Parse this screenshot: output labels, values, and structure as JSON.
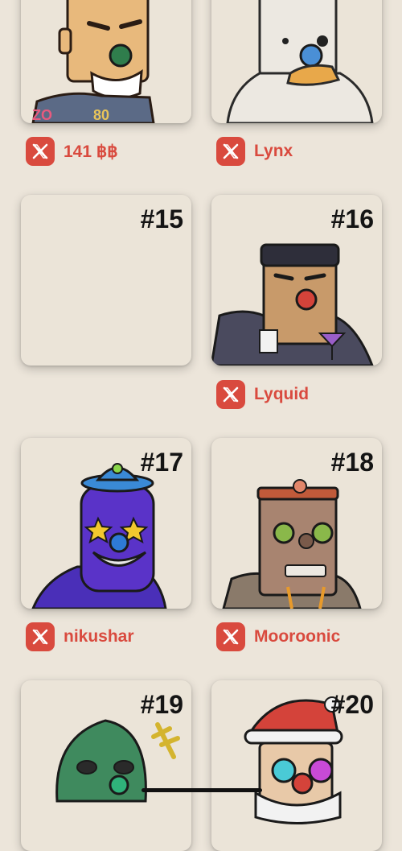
{
  "cards": [
    {
      "number": "",
      "owner": "141 ฿฿"
    },
    {
      "number": "",
      "owner": "Lynx"
    },
    {
      "number": "#15",
      "owner": ""
    },
    {
      "number": "#16",
      "owner": "Lyquid"
    },
    {
      "number": "#17",
      "owner": "nikushar"
    },
    {
      "number": "#18",
      "owner": "Mooroonic"
    },
    {
      "number": "#19",
      "owner": ""
    },
    {
      "number": "#20",
      "owner": ""
    }
  ],
  "colors": {
    "background": "#ece5da",
    "card": "#ebe4d8",
    "accent": "#d94a3e"
  },
  "icons": {
    "owner_badge": "x-logo-icon"
  }
}
